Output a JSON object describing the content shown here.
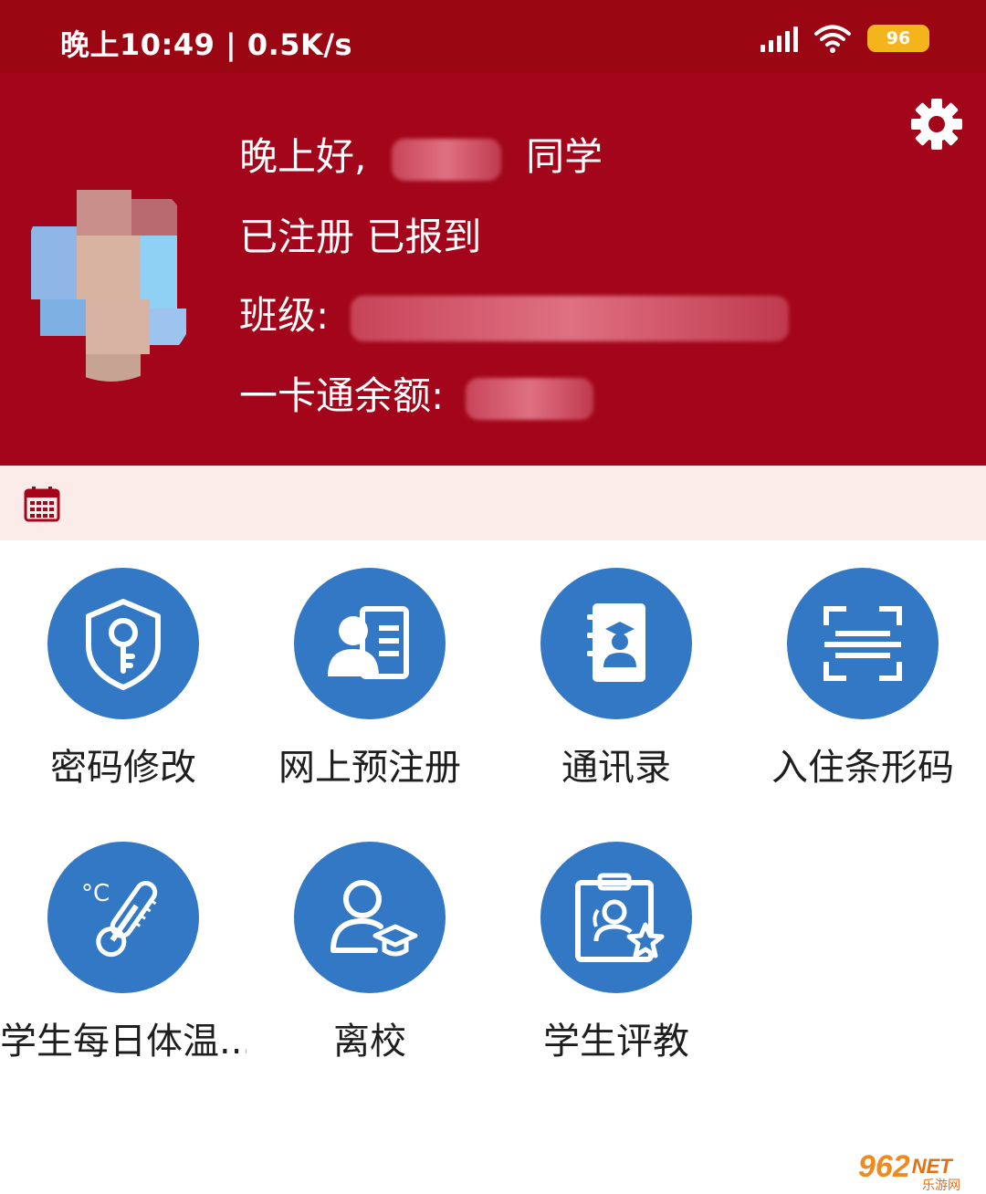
{
  "status_bar": {
    "time": "晚上10:49 | 0.5K/s",
    "battery": "96",
    "icons": [
      "signal-icon",
      "wifi-icon",
      "battery-icon"
    ],
    "color": "#9a0612"
  },
  "header": {
    "greeting_prefix": "晚上好,",
    "greeting_suffix": "同学",
    "status": "已注册 已报到",
    "class_label": "班级:",
    "card_label": "一卡通余额:",
    "settings_icon": "gear-icon",
    "color": "#a3061a"
  },
  "calendar": {
    "icon": "calendar-icon",
    "strip_color": "#fbecea"
  },
  "grid": {
    "accent": "#3378c4",
    "items": [
      {
        "label": "密码修改",
        "icon": "shield-key-icon"
      },
      {
        "label": "网上预注册",
        "icon": "id-card-icon"
      },
      {
        "label": "通讯录",
        "icon": "contact-book-icon"
      },
      {
        "label": "入住条形码",
        "icon": "scan-icon"
      },
      {
        "label": "学生每日体温...",
        "icon": "thermometer-icon"
      },
      {
        "label": "离校",
        "icon": "graduate-user-icon"
      },
      {
        "label": "学生评教",
        "icon": "clipboard-star-icon"
      }
    ]
  },
  "watermark": {
    "text": "962",
    "suffix": "NET",
    "sub": "乐游网"
  }
}
